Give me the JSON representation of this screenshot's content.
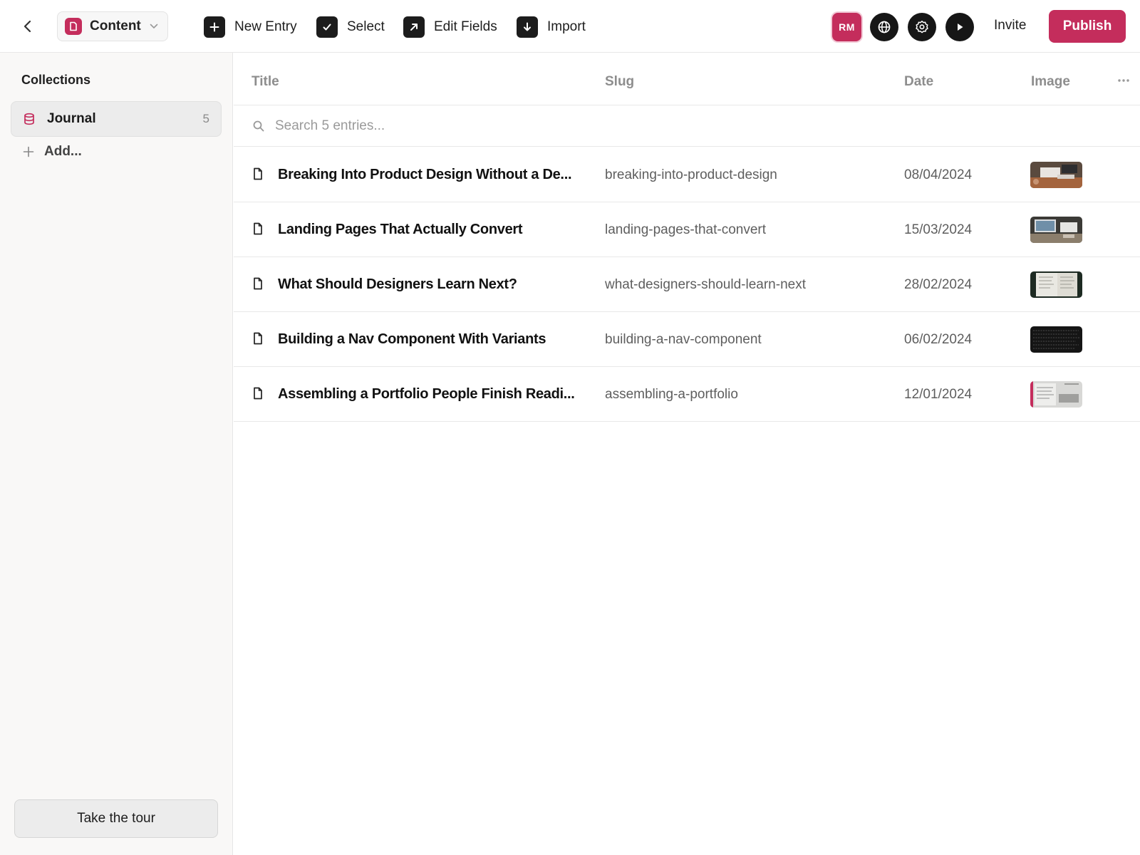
{
  "topbar": {
    "content_label": "Content",
    "tools": [
      {
        "label": "New Entry"
      },
      {
        "label": "Select"
      },
      {
        "label": "Edit Fields"
      },
      {
        "label": "Import"
      }
    ],
    "avatar_initials": "RM",
    "invite_label": "Invite",
    "publish_label": "Publish"
  },
  "sidebar": {
    "heading": "Collections",
    "collections": [
      {
        "name": "Journal",
        "count": "5"
      }
    ],
    "add_label": "Add...",
    "tour_label": "Take the tour"
  },
  "table": {
    "columns": [
      "Title",
      "Slug",
      "Date",
      "Image"
    ],
    "search_placeholder": "Search 5 entries...",
    "rows": [
      {
        "title": "Breaking Into Product Design Without a De...",
        "slug": "breaking-into-product-design",
        "date": "08/04/2024"
      },
      {
        "title": "Landing Pages That Actually Convert",
        "slug": "landing-pages-that-convert",
        "date": "15/03/2024"
      },
      {
        "title": "What Should Designers Learn Next?",
        "slug": "what-designers-should-learn-next",
        "date": "28/02/2024"
      },
      {
        "title": "Building a Nav Component With Variants",
        "slug": "building-a-nav-component",
        "date": "06/02/2024"
      },
      {
        "title": "Assembling a Portfolio People Finish Readi...",
        "slug": "assembling-a-portfolio",
        "date": "12/01/2024"
      }
    ]
  },
  "colors": {
    "accent": "#c42d5c",
    "dark": "#161616",
    "sidebar_bg": "#f9f8f7"
  },
  "icons": [
    "chevron-left-icon",
    "page-icon",
    "chevron-down-icon",
    "plus-icon",
    "check-icon",
    "arrow-up-right-icon",
    "arrow-down-icon",
    "globe-icon",
    "gear-icon",
    "play-icon",
    "database-icon",
    "search-icon",
    "more-icon",
    "document-icon"
  ]
}
